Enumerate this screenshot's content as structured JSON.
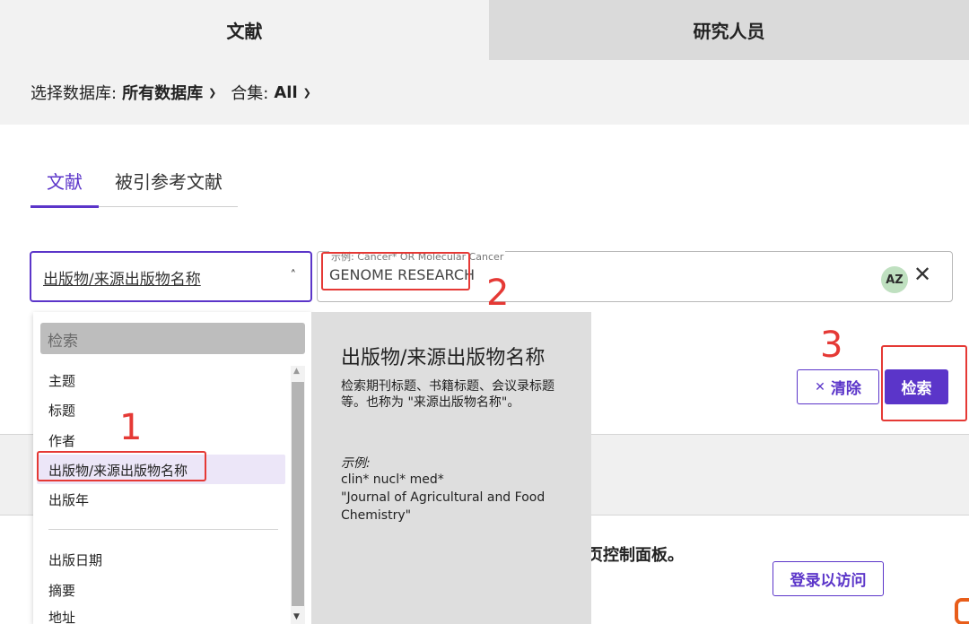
{
  "top_tabs": {
    "active": "文献",
    "inactive": "研究人员"
  },
  "database_row": {
    "db_label": "选择数据库:",
    "db_value": "所有数据库",
    "coll_label": "合集:",
    "coll_value": "All"
  },
  "sub_tabs": {
    "active": "文献",
    "inactive": "被引参考文献"
  },
  "field_select": {
    "value": "出版物/来源出版物名称"
  },
  "query": {
    "placeholder": "示例: Cancer* OR Molecular Cancer",
    "value": "GENOME RESEARCH",
    "az_label": "AZ"
  },
  "buttons": {
    "clear": "清除",
    "search": "检索",
    "login": "登录以访问"
  },
  "lower_card": {
    "text": "页控制面板。"
  },
  "dropdown": {
    "search_placeholder": "检索",
    "items": [
      "主题",
      "标题",
      "作者",
      "出版物/来源出版物名称",
      "出版年",
      "出版日期",
      "摘要",
      "地址"
    ],
    "selected_index": 3
  },
  "help": {
    "title": "出版物/来源出版物名称",
    "description": "检索期刊标题、书籍标题、会议录标题等。也称为 \"来源出版物名称\"。",
    "example_label": "示例:",
    "examples": [
      "clin* nucl* med*",
      "\"Journal of Agricultural and Food",
      "Chemistry\""
    ]
  },
  "annotations": {
    "n1": "1",
    "n2": "2",
    "n3": "3",
    "color": "#e53935"
  },
  "colors": {
    "accent": "#5b35c9"
  }
}
